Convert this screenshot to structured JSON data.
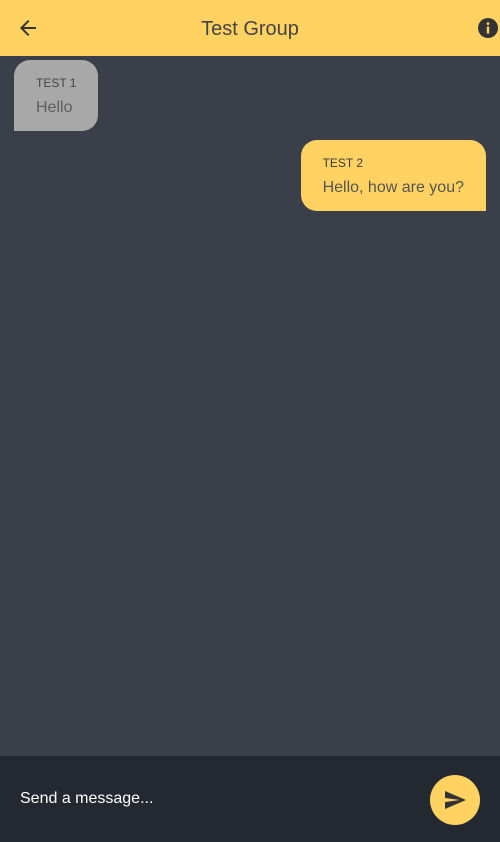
{
  "header": {
    "title": "Test Group",
    "back_icon": "arrow-left-icon",
    "info_icon": "info-icon"
  },
  "messages": [
    {
      "sender": "TEST 1",
      "text": "Hello",
      "side": "left"
    },
    {
      "sender": "TEST 2",
      "text": "Hello, how are you?",
      "side": "right"
    }
  ],
  "composer": {
    "placeholder": "Send a message...",
    "value": "",
    "send_icon": "send-icon"
  },
  "colors": {
    "accent": "#ffd262",
    "background": "#3b3f49",
    "composer_bg": "#242830",
    "incoming_bubble": "#a8a8a8"
  }
}
